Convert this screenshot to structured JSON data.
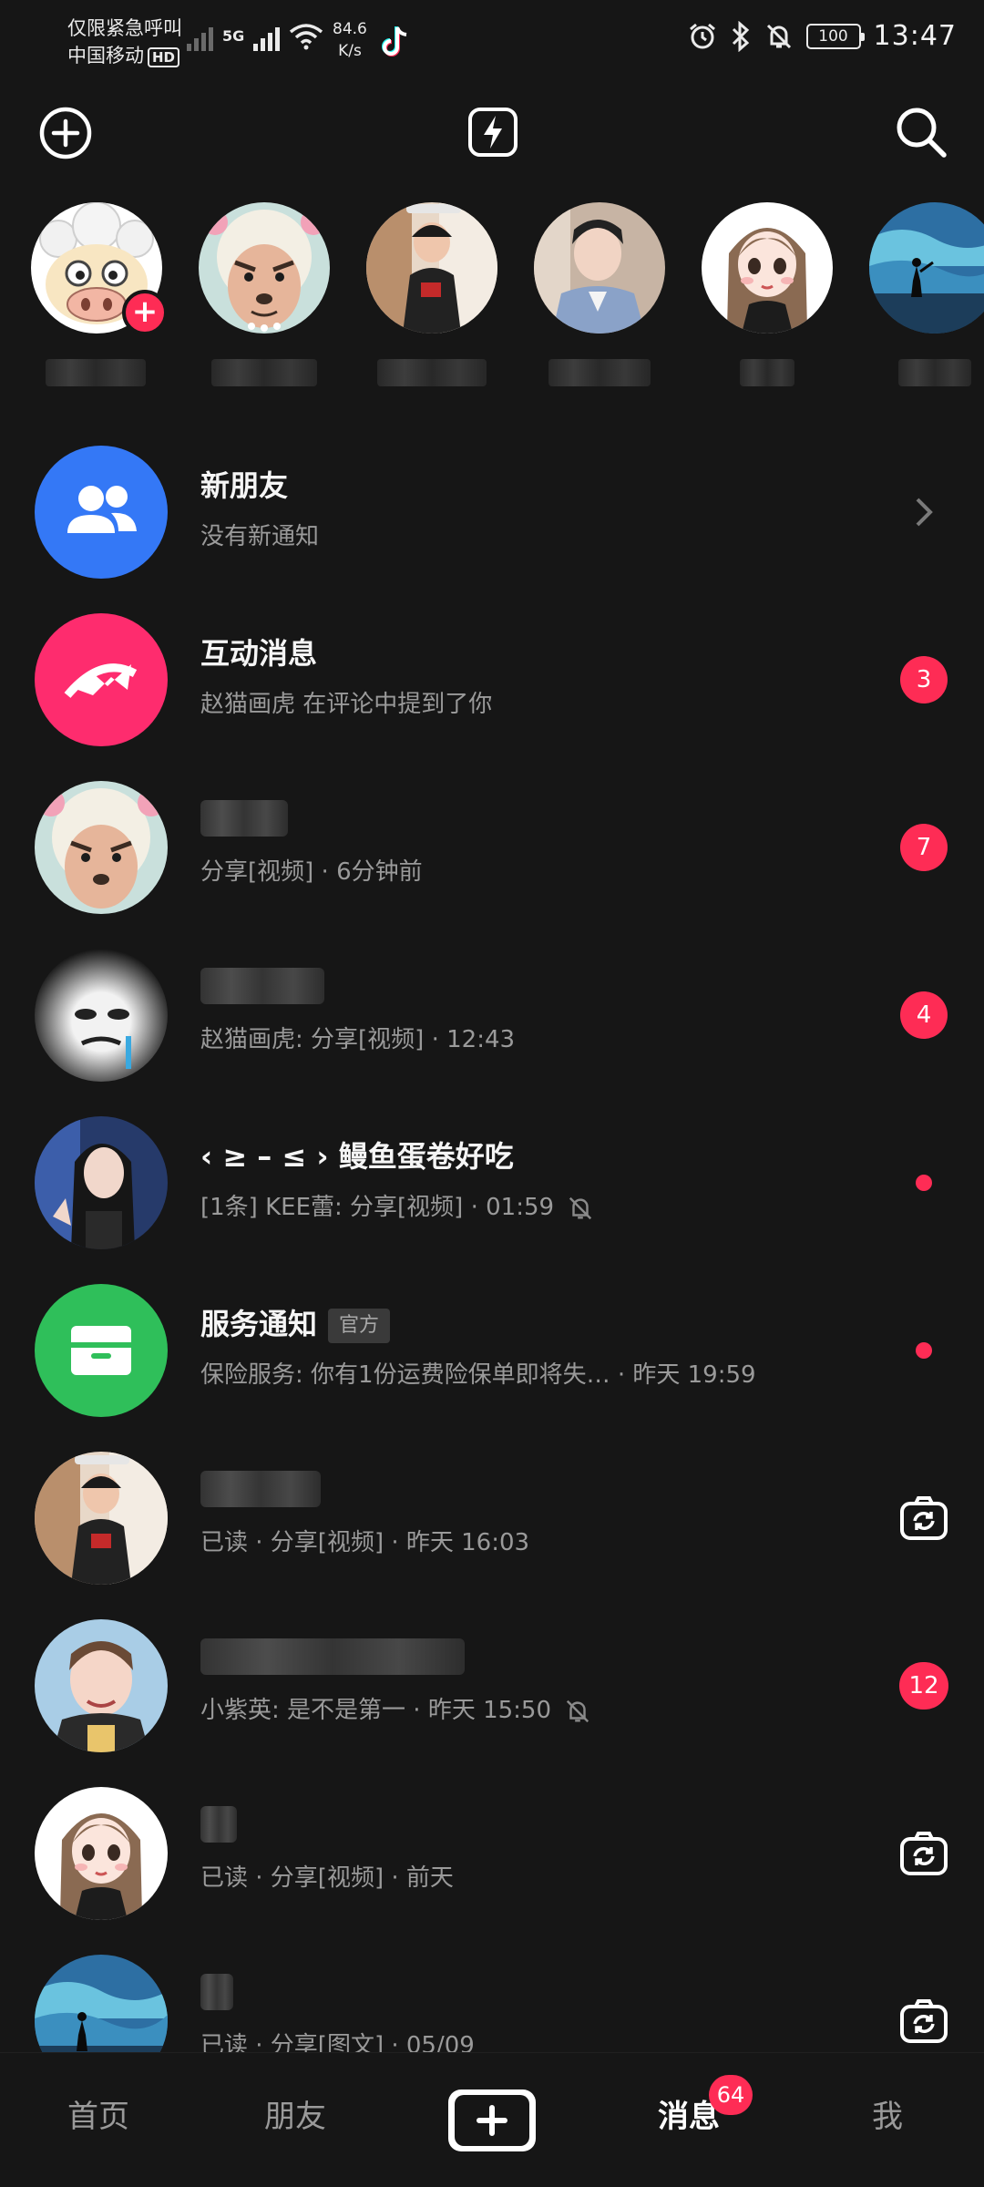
{
  "status_bar": {
    "carrier_line1": "仅限紧急呼叫",
    "carrier_line2": "中国移动",
    "hd": "HD",
    "network": "5G",
    "speed_value": "84.6",
    "speed_unit": "K/s",
    "battery": "100",
    "time": "13:47"
  },
  "header": {
    "add_icon": "add-circle-icon",
    "flash_icon": "flash-icon",
    "search_icon": "search-icon"
  },
  "stories": [
    {
      "avatar": "cartoon-sheep-avatar",
      "has_add": true,
      "add_label": "+"
    },
    {
      "avatar": "cartoon-wolf-avatar"
    },
    {
      "avatar": "photo-avatar"
    },
    {
      "avatar": "photo-avatar"
    },
    {
      "avatar": "cartoon-girl-avatar"
    },
    {
      "avatar": "landscape-avatar"
    }
  ],
  "messages": [
    {
      "title": "新朋友",
      "subtitle": "没有新通知",
      "right": "chevron"
    },
    {
      "title": "互动消息",
      "subtitle": "赵猫画虎 在评论中提到了你",
      "badge": "3"
    },
    {
      "title": "",
      "subtitle": "分享[视频] · 6分钟前",
      "badge": "7"
    },
    {
      "title": "",
      "subtitle": "赵猫画虎: 分享[视频] · 12:43",
      "badge": "4"
    },
    {
      "title": "‹ ≥ – ≤ › 鳗鱼蛋卷好吃",
      "subtitle": "[1条] KEE蕾: 分享[视频] · 01:59",
      "dot": true,
      "muted": true
    },
    {
      "title": "服务通知",
      "tag": "官方",
      "subtitle": "保险服务: 你有1份运费险保单即将失… · 昨天 19:59",
      "dot": true
    },
    {
      "title": "",
      "subtitle": "已读 · 分享[视频] · 昨天 16:03",
      "right": "camera"
    },
    {
      "title": "",
      "subtitle": "小紫英: 是不是第一 · 昨天 15:50",
      "badge": "12",
      "muted": true
    },
    {
      "title": "",
      "subtitle": "已读 · 分享[视频] · 前天",
      "right": "camera"
    },
    {
      "title": "",
      "subtitle": "已读 · 分享[图文] · 05/09",
      "right": "camera"
    }
  ],
  "bottom_nav": {
    "home": "首页",
    "friends": "朋友",
    "messages": "消息",
    "messages_badge": "64",
    "me": "我"
  },
  "colors": {
    "background": "#161616",
    "accent": "#fe2c55",
    "new_friends_icon_bg": "#3478f6",
    "interaction_icon_bg": "#fe2c6e",
    "service_icon_bg": "#2fbf5a"
  }
}
